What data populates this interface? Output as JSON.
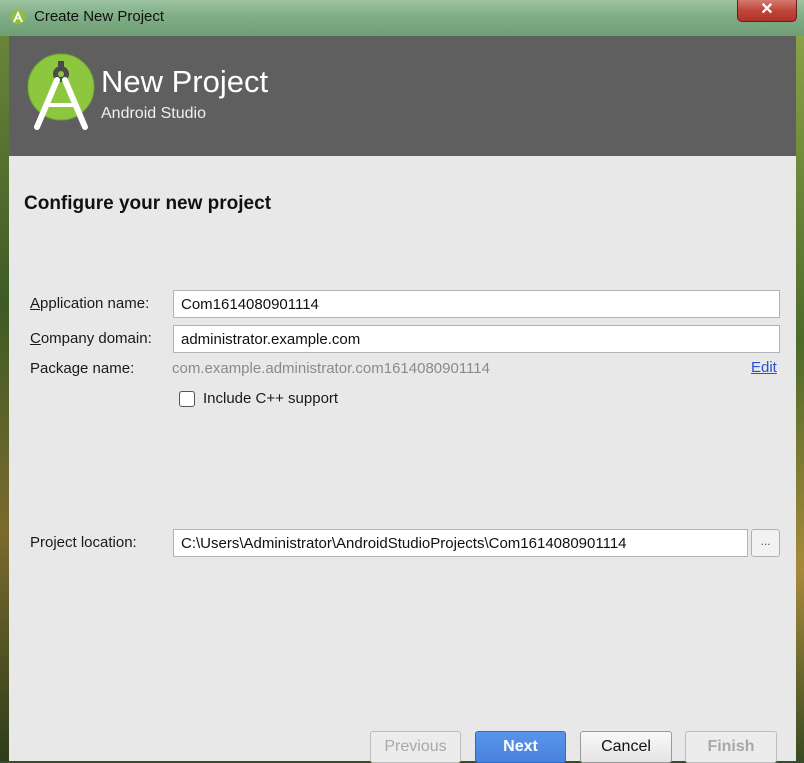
{
  "window": {
    "title": "Create New Project",
    "close_label": "✕"
  },
  "header": {
    "title": "New Project",
    "subtitle": "Android Studio"
  },
  "section": {
    "title": "Configure your new project"
  },
  "form": {
    "app_name": {
      "label_mnemonic": "A",
      "label_rest": "pplication name:",
      "value": "Com1614080901114"
    },
    "company_domain": {
      "label_mnemonic": "C",
      "label_rest": "ompany domain:",
      "value": "administrator.example.com"
    },
    "package_name": {
      "label": "Package name:",
      "value": "com.example.administrator.com1614080901114",
      "edit_label": "Edit"
    },
    "cpp_support": {
      "label": "Include C++ support",
      "checked": false
    },
    "project_location": {
      "label": "Project location:",
      "value": "C:\\Users\\Administrator\\AndroidStudioProjects\\Com1614080901114",
      "browse_label": "..."
    }
  },
  "buttons": {
    "previous": "Previous",
    "next": "Next",
    "cancel": "Cancel",
    "finish": "Finish"
  },
  "colors": {
    "header_bg": "#5f5f5f",
    "dialog_bg": "#e8e8e8",
    "primary_button": "#4a82dc",
    "link": "#2a4fd6",
    "android_green": "#a4c639"
  }
}
